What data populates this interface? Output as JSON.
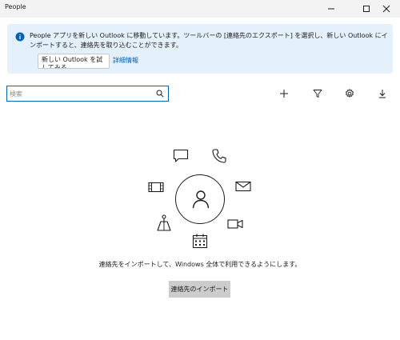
{
  "window": {
    "title": "People"
  },
  "banner": {
    "message": "People アプリを新しい Outlook に移動しています。ツールバーの [連絡先のエクスポート] を選択し、新しい Outlook にインポートすると、連絡先を取り込むことができます。",
    "try_button_label": "新しい Outlook を試してみる",
    "details_link": "詳細情報"
  },
  "search": {
    "placeholder": "検索"
  },
  "toolbar": {
    "add": "plus-icon",
    "filter": "filter-icon",
    "settings": "gear-icon",
    "export": "download-icon"
  },
  "empty_state": {
    "message": "連絡先をインポートして、Windows 全体で利用できるようにします。",
    "import_button_label": "連絡先のインポート"
  },
  "colors": {
    "banner_bg": "#e4f0fb",
    "link": "#0063b1",
    "search_border": "#0063b1",
    "button_bg": "#cccccc"
  }
}
